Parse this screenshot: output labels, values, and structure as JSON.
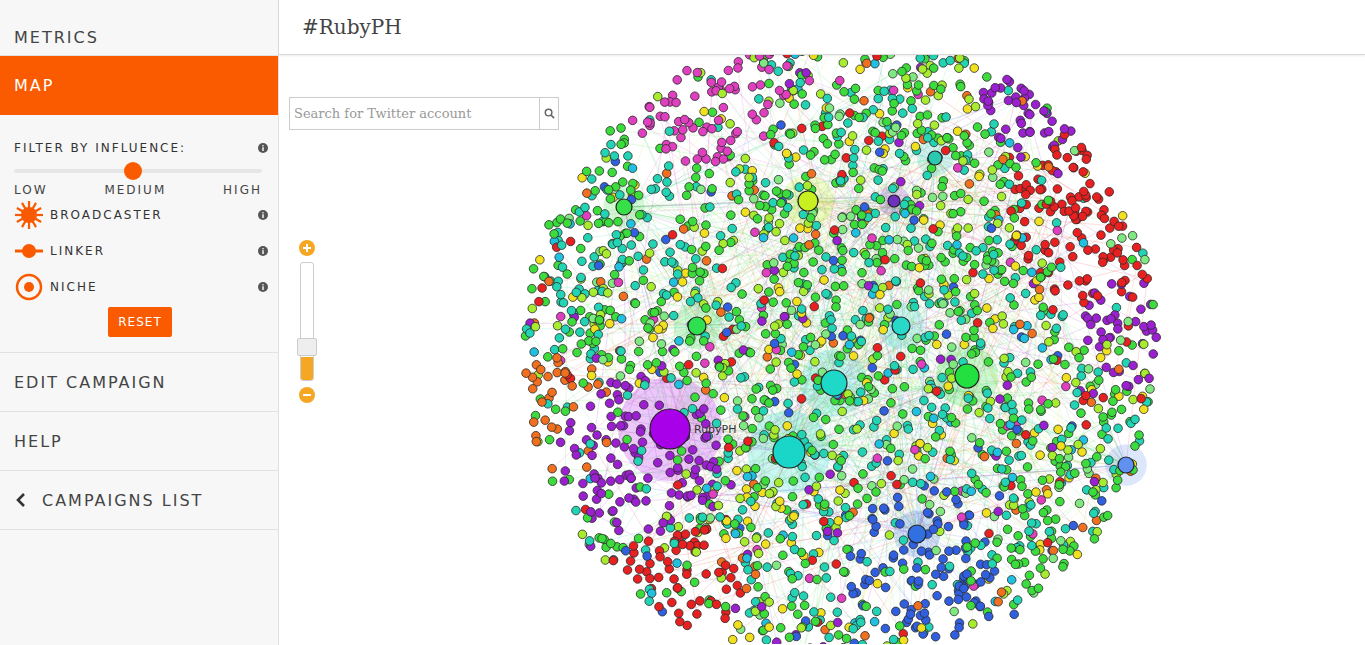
{
  "window": {
    "title": "#RubyPH"
  },
  "sidebar": {
    "items": [
      {
        "label": "METRICS",
        "selected": false
      },
      {
        "label": "MAP",
        "selected": true
      }
    ],
    "filter": {
      "title": "FILTER BY INFLUENCE:",
      "level": 0.48,
      "ticks": [
        "LOW",
        "MEDIUM",
        "HIGH"
      ],
      "legend": [
        {
          "label": "BROADCASTER",
          "kind": "broadcaster"
        },
        {
          "label": "LINKER",
          "kind": "linker"
        },
        {
          "label": "NICHE",
          "kind": "niche"
        }
      ],
      "reset": "RESET"
    },
    "bottom_items": [
      {
        "label": "EDIT CAMPAIGN",
        "kind": "link"
      },
      {
        "label": "HELP",
        "kind": "link"
      },
      {
        "label": "CAMPAIGNS LIST",
        "kind": "back"
      }
    ]
  },
  "search": {
    "placeholder": "Search for Twitter account"
  },
  "zoom": {
    "level": 0.2
  },
  "graph": {
    "community_colors": [
      "#3ddc3d",
      "#22d4b4",
      "#a8ec30",
      "#f0e020",
      "#e82020",
      "#9b20d0",
      "#e040c0",
      "#3060e0",
      "#f07020",
      "#20c0e0",
      "#80e880"
    ],
    "hubs": [
      {
        "color": "#a800e8",
        "label": "RubyPH"
      },
      {
        "color": "#19d6c8"
      },
      {
        "color": "#1ed8c8"
      },
      {
        "color": "#22e040"
      },
      {
        "color": "#c8f020"
      },
      {
        "color": "#28d8c8"
      },
      {
        "color": "#2ee050"
      },
      {
        "color": "#36e046"
      },
      {
        "color": "#2cc8b0"
      },
      {
        "color": "#3070e0"
      },
      {
        "color": "#6090f0"
      },
      {
        "color": "#7030c0"
      }
    ]
  }
}
